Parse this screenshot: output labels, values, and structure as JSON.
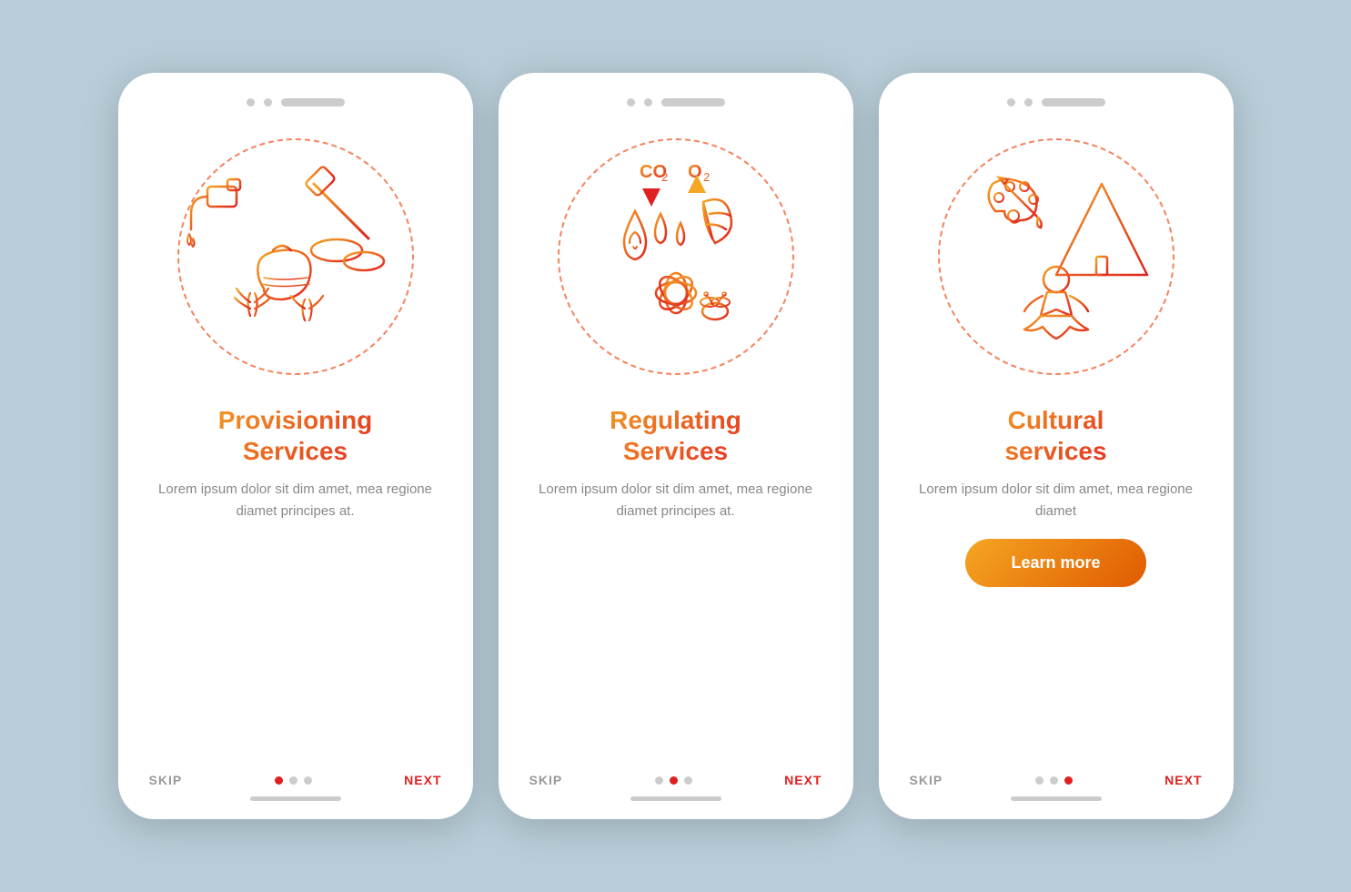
{
  "background": "#b8cdd8",
  "phones": [
    {
      "id": "provisioning",
      "title": "Provisioning\nServices",
      "description": "Lorem ipsum dolor sit dim amet, mea regione diamet principes at.",
      "show_button": false,
      "button_label": "",
      "active_dot": 0,
      "skip_label": "SKIP",
      "next_label": "NEXT"
    },
    {
      "id": "regulating",
      "title": "Regulating\nServices",
      "description": "Lorem ipsum dolor sit dim amet, mea regione diamet principes at.",
      "show_button": false,
      "button_label": "",
      "active_dot": 1,
      "skip_label": "SKIP",
      "next_label": "NEXT"
    },
    {
      "id": "cultural",
      "title": "Cultural\nservices",
      "description": "Lorem ipsum dolor sit dim amet, mea regione diamet",
      "show_button": true,
      "button_label": "Learn more",
      "active_dot": 2,
      "skip_label": "SKIP",
      "next_label": "NEXT"
    }
  ]
}
